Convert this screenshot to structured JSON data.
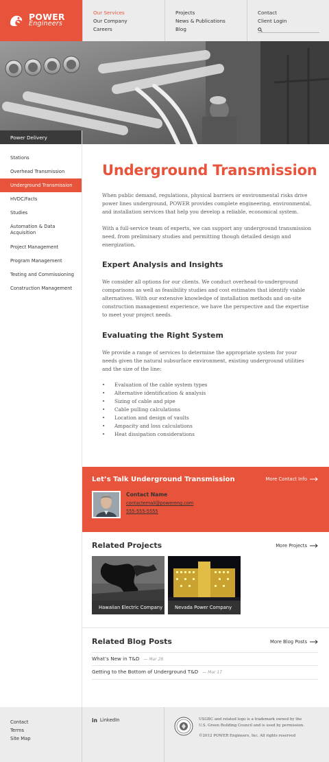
{
  "brand": {
    "line1": "POWER",
    "line2": "Engineers",
    "color": "#e8533b"
  },
  "nav": {
    "col1": [
      "Our Services",
      "Our Company",
      "Careers"
    ],
    "col2": [
      "Projects",
      "News & Publications",
      "Blog"
    ],
    "col3": [
      "Contact",
      "Client Login"
    ],
    "active": "Our Services"
  },
  "sidebar": {
    "heading": "Power Delivery",
    "items": [
      {
        "label": "Stations"
      },
      {
        "label": "Overhead Transmission"
      },
      {
        "label": "Underground Transmission",
        "active": true
      },
      {
        "label": "HVDC/Facts"
      },
      {
        "label": "Studies"
      },
      {
        "label": "Automation & Data Acquisition"
      },
      {
        "label": "Project Management"
      },
      {
        "label": "Program Management"
      },
      {
        "label": "Testing and Commissioning"
      },
      {
        "label": "Construction Management"
      }
    ]
  },
  "page": {
    "title": "Underground Transmission",
    "intro1": "When public demand, regulations, physical barriers or environmental risks drive power lines underground, POWER provides complete engineering, environmental, and installation services that help you develop a reliable, economical system.",
    "intro2": "With a full-service team of experts, we can support any underground transmission need, from preliminary studies and permitting though detailed design and energization.",
    "h_expert": "Expert Analysis and Insights",
    "expert_text": "We consider all options for our clients. We conduct overhead-to-underground comparisons as well as feasibility studies and cost estimates that identify viable alternatives. With our extensive knowledge of installation methods and on-site construction management experience, we have the perspective and the expertise to meet your project needs.",
    "h_eval": "Evaluating the Right System",
    "eval_text": "We provide a range of services to determine the appropriate system for your needs given the natural subsurface environment, existing underground utilities and the size of the line:",
    "bullets": [
      "Evaluation of the cable system types",
      "Alternative identification & analysis",
      "Sizing of cable and pipe",
      "Cable pulling calculations",
      "Location and design of vaults",
      "Ampacity and loss calculations",
      "Heat dissipation considerations"
    ]
  },
  "contact": {
    "title": "Let’s Talk Underground Transmission",
    "more": "More Contact Info",
    "name": "Contact Name",
    "email": "contactemail@powereng.com",
    "phone": "555-555-5555"
  },
  "projects": {
    "title": "Related Projects",
    "more": "More Projects",
    "items": [
      "Hawaiian Electric Company",
      "Nevada Power Company"
    ]
  },
  "blog": {
    "title": "Related Blog Posts",
    "more": "More Blog Posts",
    "posts": [
      {
        "title": "What’s New in T&D",
        "date": "Mar 28"
      },
      {
        "title": "Getting to the Bottom of Underground T&D",
        "date": "Mar 17"
      }
    ]
  },
  "footer": {
    "links": [
      "Contact",
      "Terms",
      "Site Map"
    ],
    "social": "LinkedIn",
    "legal1": "USGBC and related logo is a trademark owned by the U.S. Green Building Council and is used by permission.",
    "legal2": "©2012 POWER Engineers, Inc. All rights reserved"
  }
}
